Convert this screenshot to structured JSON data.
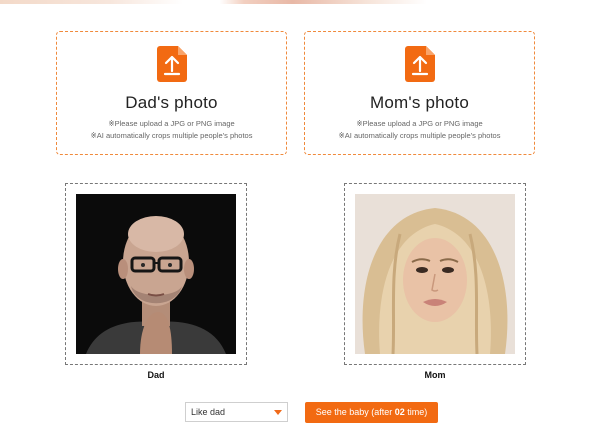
{
  "colors": {
    "accent": "#f26a12",
    "border": "#f08a3c"
  },
  "dad_upload": {
    "icon": "upload-file-icon",
    "title": "Dad's photo",
    "hint1": "※Please upload a JPG or PNG image",
    "hint2": "※AI automatically crops multiple people's photos"
  },
  "mom_upload": {
    "icon": "upload-file-icon",
    "title": "Mom's photo",
    "hint1": "※Please upload a JPG or PNG image",
    "hint2": "※AI automatically crops multiple people's photos"
  },
  "photos": {
    "dad_caption": "Dad",
    "mom_caption": "Mom"
  },
  "controls": {
    "resemblance_selected": "Like dad",
    "cta_prefix": "See the baby (after ",
    "cta_count": "02",
    "cta_suffix": " time)"
  }
}
